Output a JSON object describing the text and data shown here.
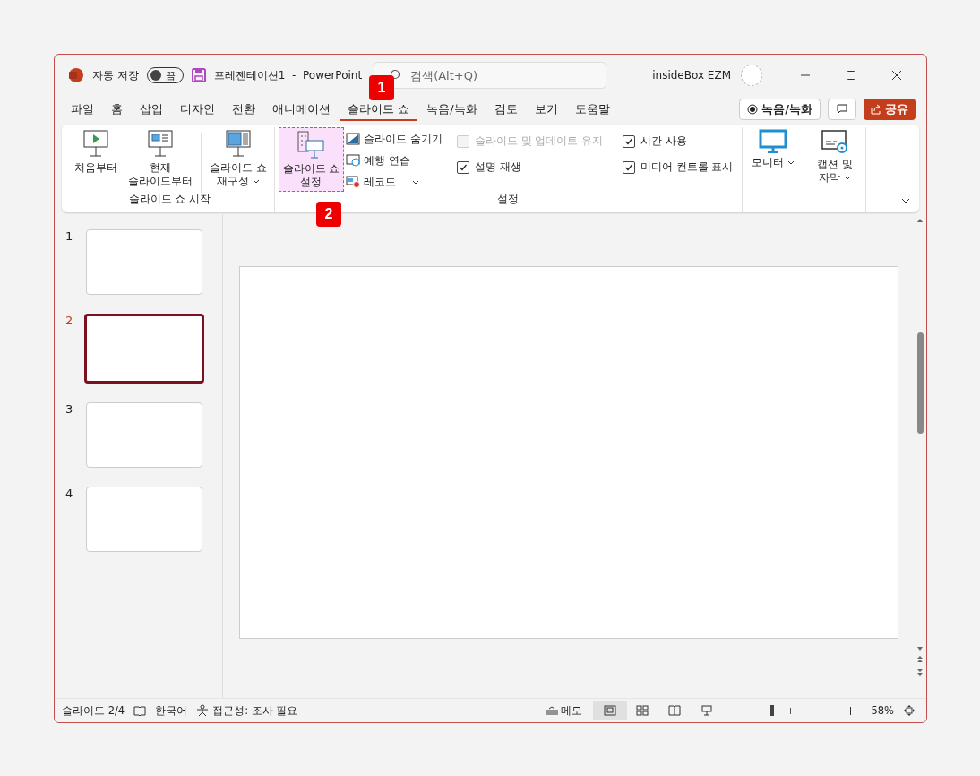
{
  "titlebar": {
    "autosave_label": "자동 저장",
    "autosave": {
      "on": false,
      "label": "끔"
    },
    "doc_title": "프레젠테이션1  -  PowerPoint",
    "search": {
      "placeholder": "검색(Alt+Q)"
    },
    "user": "insideBox EZM"
  },
  "tabs": [
    {
      "label": "파일",
      "selected": false
    },
    {
      "label": "홈",
      "selected": false
    },
    {
      "label": "삽입",
      "selected": false
    },
    {
      "label": "디자인",
      "selected": false
    },
    {
      "label": "전환",
      "selected": false
    },
    {
      "label": "애니메이션",
      "selected": false
    },
    {
      "label": "슬라이드 쇼",
      "selected": true
    },
    {
      "label": "녹음/녹화",
      "selected": false
    },
    {
      "label": "검토",
      "selected": false
    },
    {
      "label": "보기",
      "selected": false
    },
    {
      "label": "도움말",
      "selected": false
    }
  ],
  "tab_actions": {
    "record": "녹음/녹화",
    "share": "공유"
  },
  "ribbon": {
    "groups": [
      {
        "label": "슬라이드 쇼 시작",
        "columns": [
          {
            "kind": "large",
            "items": [
              {
                "label": "처음부터",
                "dropdown": false,
                "selected": false
              }
            ]
          },
          {
            "kind": "large",
            "items": [
              {
                "label": "현재\n슬라이드부터",
                "dropdown": false,
                "selected": false
              }
            ]
          },
          {
            "kind": "separator"
          },
          {
            "kind": "large",
            "items": [
              {
                "label": "슬라이드 쇼\n재구성",
                "dropdown": true,
                "selected": false
              }
            ]
          }
        ]
      },
      {
        "label": "설정",
        "columns": [
          {
            "kind": "large",
            "items": [
              {
                "label": "슬라이드 쇼\n설정",
                "dropdown": false,
                "selected": true
              }
            ]
          },
          {
            "kind": "small",
            "items": [
              {
                "label": "슬라이드 숨기기",
                "dropdown": false
              },
              {
                "label": "예행 연습",
                "dropdown": false
              },
              {
                "label": "레코드",
                "dropdown": true
              }
            ]
          },
          {
            "kind": "check",
            "items": [
              {
                "label": "슬라이드 및 업데이트 유지",
                "checked": false,
                "disabled": true
              },
              {
                "label": "설명 재생",
                "checked": true,
                "disabled": false
              }
            ]
          },
          {
            "kind": "check",
            "items": [
              {
                "label": "시간 사용",
                "checked": true,
                "disabled": false
              },
              {
                "label": "미디어 컨트롤 표시",
                "checked": true,
                "disabled": false
              }
            ]
          }
        ]
      },
      {
        "columns": [
          {
            "kind": "large",
            "items": [
              {
                "label": "모니터",
                "dropdown": true,
                "selected": false
              }
            ]
          }
        ]
      },
      {
        "columns": [
          {
            "kind": "large",
            "items": [
              {
                "label": "캡션 및\n자막",
                "dropdown": true,
                "selected": false
              }
            ]
          }
        ]
      }
    ]
  },
  "slides": [
    {
      "number": "1",
      "selected": false
    },
    {
      "number": "2",
      "selected": true
    },
    {
      "number": "3",
      "selected": false
    },
    {
      "number": "4",
      "selected": false
    }
  ],
  "status_bar": {
    "slide": "슬라이드 2/4",
    "language": "한국어",
    "accessibility": "접근성: 조사 필요",
    "notes": "메모",
    "views": [
      {
        "selected": true
      },
      {
        "selected": false
      },
      {
        "selected": false
      },
      {
        "selected": false
      }
    ],
    "zoom": {
      "level": 0.29,
      "reading": "58%"
    }
  },
  "annotations": [
    {
      "label": "1"
    },
    {
      "label": "2"
    }
  ]
}
